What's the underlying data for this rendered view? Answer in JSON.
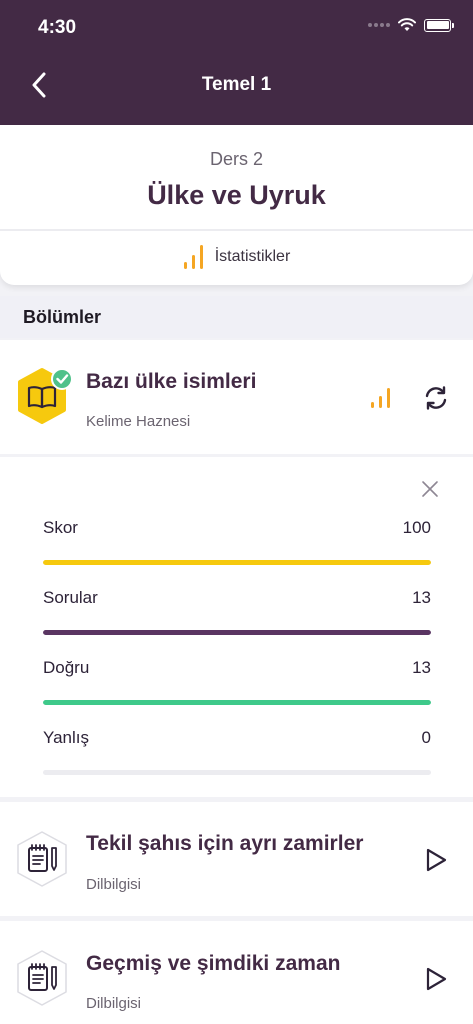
{
  "status_bar": {
    "time": "4:30"
  },
  "nav": {
    "title": "Temel 1",
    "back_icon": "chevron-left-icon"
  },
  "lesson": {
    "subtitle": "Ders 2",
    "title": "Ülke ve Uyruk",
    "stats_label": "İstatistikler"
  },
  "sections": {
    "title": "Bölümler"
  },
  "units": [
    {
      "title": "Bazı ülke isimleri",
      "subtitle": "Kelime Haznesi",
      "icon": "book-icon",
      "completed": true
    },
    {
      "title": "Tekil şahıs için ayrı zamirler",
      "subtitle": "Dilbilgisi",
      "icon": "notepad-pencil-icon"
    },
    {
      "title": "Geçmiş ve şimdiki zaman",
      "subtitle": "Dilbilgisi",
      "icon": "notepad-pencil-icon"
    }
  ],
  "stats": [
    {
      "label": "Skor",
      "value": "100",
      "fill_percent": 100,
      "color": "#f6c90e"
    },
    {
      "label": "Sorular",
      "value": "13",
      "fill_percent": 100,
      "color": "#5a3562"
    },
    {
      "label": "Doğru",
      "value": "13",
      "fill_percent": 100,
      "color": "#3ec98a"
    },
    {
      "label": "Yanlış",
      "value": "0",
      "fill_percent": 0,
      "color": "#e5e5ea"
    }
  ],
  "colors": {
    "brand": "#432a45",
    "accent": "#f5a623",
    "success": "#4fc18a",
    "unit_badge": "#f6c90e"
  }
}
